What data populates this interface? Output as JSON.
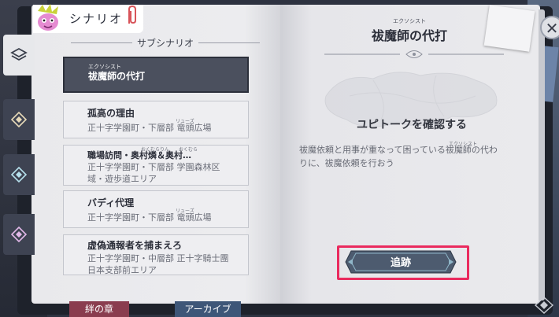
{
  "header": {
    "title": "シナリオ"
  },
  "left_page": {
    "subheading": "サブシナリオ",
    "items": [
      {
        "ruby": "エクソシスト",
        "title": "祓魔師の代打",
        "location": "",
        "selected": true
      },
      {
        "ruby": "",
        "title": "孤高の理由",
        "location_ruby": "リューズ",
        "location": "正十字学園町・下層部 竜頭広場",
        "selected": false
      },
      {
        "ruby": "",
        "title": "職場訪問・奥村燐＆奥村…",
        "title_ruby": "おくむらりん　　おくむら",
        "location": "正十字学園町・下層部 学園森林区域・遊歩道エリア",
        "location_line1": "正十字学園町・下層部 学園森林区",
        "location_line2": "域・遊歩道エリア",
        "selected": false
      },
      {
        "ruby": "",
        "title": "バディ代理",
        "location_ruby": "リューズ",
        "location": "正十字学園町・下層部 竜頭広場",
        "selected": false
      },
      {
        "ruby": "",
        "title": "虚偽通報者を捕まえろ",
        "location": "正十字学園町・中層部 正十字騎士團日本支部前エリア",
        "location_line1": "正十字学園町・中層部 正十字騎士團",
        "location_line2": "日本支部前エリア",
        "selected": false
      }
    ]
  },
  "right_page": {
    "title_ruby": "エクソシスト",
    "title": "祓魔師の代打",
    "review_button": "ユピトークを確認する",
    "description_ruby": "エクソシスト",
    "description": "祓魔依頼と用事が重なって困っている祓魔師の代わりに、祓魔依頼を行おう",
    "description_line1": "祓魔依頼と用事が重なって困っている祓魔師の代わ",
    "description_line2": "りに、祓魔依頼を行おう",
    "track_button": "追跡"
  },
  "bottom_tabs": [
    {
      "label": "絆の章"
    },
    {
      "label": "アーカイブ"
    }
  ],
  "colors": {
    "highlight": "#ea2a5e",
    "selected_item": "#4b505e",
    "page": "#ececef"
  },
  "icons": {
    "close": "close-icon",
    "layers": "layers-icon",
    "diamond": "diamond-icon"
  }
}
